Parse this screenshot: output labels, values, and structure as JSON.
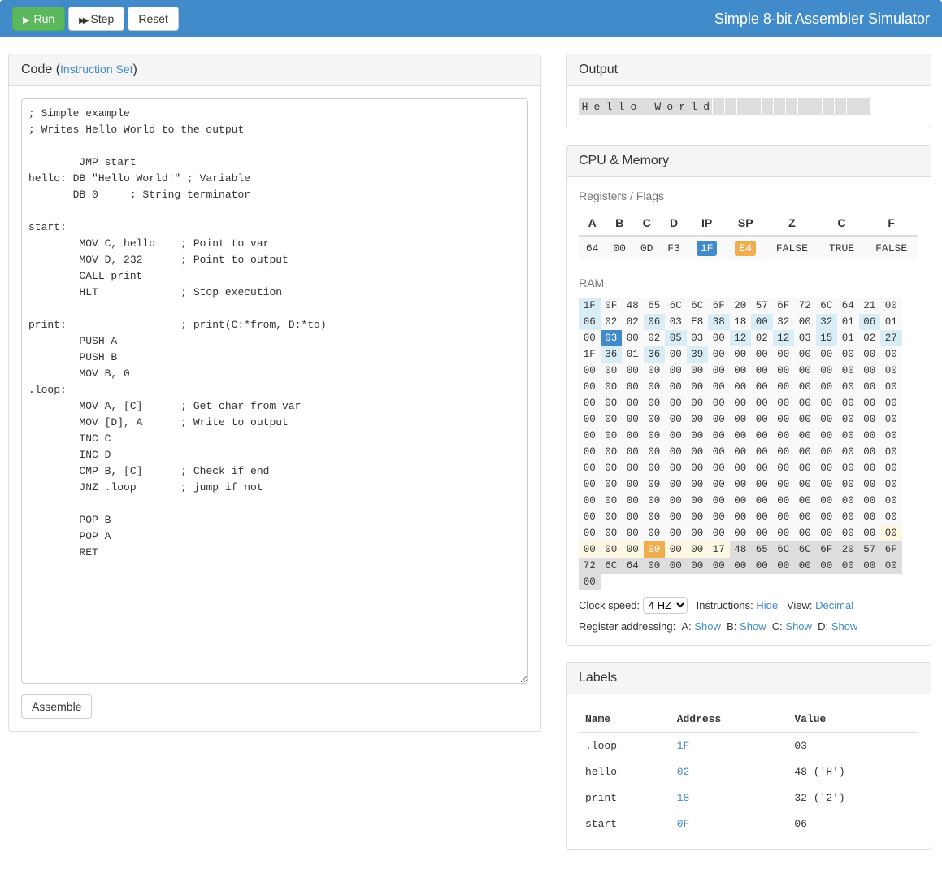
{
  "app": {
    "title": "Simple 8-bit Assembler Simulator"
  },
  "toolbar": {
    "run": "Run",
    "step": "Step",
    "reset": "Reset"
  },
  "codePanel": {
    "title": "Code",
    "instruction_set_link": "Instruction Set",
    "assemble_label": "Assemble",
    "source": "; Simple example\n; Writes Hello World to the output\n\n\tJMP start\nhello: DB \"Hello World!\" ; Variable\n       DB 0\t; String terminator\n\nstart:\n\tMOV C, hello    ; Point to var \n\tMOV D, 232\t; Point to output\n\tCALL print\n        HLT             ; Stop execution\n\nprint:\t\t\t; print(C:*from, D:*to)\n\tPUSH A\n\tPUSH B\n\tMOV B, 0\n.loop:\n\tMOV A, [C]\t; Get char from var\n\tMOV [D], A\t; Write to output\n\tINC C\n\tINC D  \n\tCMP B, [C]\t; Check if end\n\tJNZ .loop\t; jump if not\n\n\tPOP B\n\tPOP A\n\tRET"
  },
  "outputPanel": {
    "title": "Output",
    "cells": [
      "H",
      "e",
      "l",
      "l",
      "o",
      " ",
      "W",
      "o",
      "r",
      "l",
      "d",
      "",
      "",
      "",
      "",
      "",
      "",
      "",
      "",
      "",
      "",
      "",
      "",
      ""
    ]
  },
  "cpuPanel": {
    "title": "CPU & Memory",
    "registers_label": "Registers / Flags",
    "reg_headers": [
      "A",
      "B",
      "C",
      "D",
      "IP",
      "SP",
      "Z",
      "C",
      "F"
    ],
    "reg_values": [
      "64",
      "00",
      "0D",
      "F3",
      "1F",
      "E4",
      "FALSE",
      "TRUE",
      "FALSE"
    ],
    "ram_label": "RAM",
    "ram": [
      {
        "v": "1F",
        "c": "hl-lightblue"
      },
      {
        "v": "0F",
        "c": ""
      },
      {
        "v": "48",
        "c": ""
      },
      {
        "v": "65",
        "c": ""
      },
      {
        "v": "6C",
        "c": ""
      },
      {
        "v": "6C",
        "c": ""
      },
      {
        "v": "6F",
        "c": ""
      },
      {
        "v": "20",
        "c": ""
      },
      {
        "v": "57",
        "c": ""
      },
      {
        "v": "6F",
        "c": ""
      },
      {
        "v": "72",
        "c": ""
      },
      {
        "v": "6C",
        "c": ""
      },
      {
        "v": "64",
        "c": ""
      },
      {
        "v": "21",
        "c": ""
      },
      {
        "v": "00",
        "c": ""
      },
      {
        "v": "06",
        "c": "hl-lightblue"
      },
      {
        "v": "02",
        "c": ""
      },
      {
        "v": "02",
        "c": ""
      },
      {
        "v": "06",
        "c": "hl-lightblue"
      },
      {
        "v": "03",
        "c": ""
      },
      {
        "v": "E8",
        "c": ""
      },
      {
        "v": "38",
        "c": "hl-lightblue"
      },
      {
        "v": "18",
        "c": ""
      },
      {
        "v": "00",
        "c": "hl-lightblue"
      },
      {
        "v": "32",
        "c": ""
      },
      {
        "v": "00",
        "c": ""
      },
      {
        "v": "32",
        "c": "hl-lightblue"
      },
      {
        "v": "01",
        "c": ""
      },
      {
        "v": "06",
        "c": "hl-lightblue"
      },
      {
        "v": "01",
        "c": ""
      },
      {
        "v": "00",
        "c": ""
      },
      {
        "v": "03",
        "c": "hl-ip"
      },
      {
        "v": "00",
        "c": ""
      },
      {
        "v": "02",
        "c": ""
      },
      {
        "v": "05",
        "c": "hl-lightblue"
      },
      {
        "v": "03",
        "c": ""
      },
      {
        "v": "00",
        "c": ""
      },
      {
        "v": "12",
        "c": "hl-lightblue"
      },
      {
        "v": "02",
        "c": ""
      },
      {
        "v": "12",
        "c": "hl-lightblue"
      },
      {
        "v": "03",
        "c": ""
      },
      {
        "v": "15",
        "c": "hl-lightblue"
      },
      {
        "v": "01",
        "c": ""
      },
      {
        "v": "02",
        "c": ""
      },
      {
        "v": "27",
        "c": "hl-lightblue"
      },
      {
        "v": "1F",
        "c": ""
      },
      {
        "v": "36",
        "c": "hl-lightblue"
      },
      {
        "v": "01",
        "c": ""
      },
      {
        "v": "36",
        "c": "hl-lightblue"
      },
      {
        "v": "00",
        "c": ""
      },
      {
        "v": "39",
        "c": "hl-lightblue"
      },
      {
        "v": "00",
        "c": ""
      },
      {
        "v": "00",
        "c": ""
      },
      {
        "v": "00",
        "c": ""
      },
      {
        "v": "00",
        "c": ""
      },
      {
        "v": "00",
        "c": ""
      },
      {
        "v": "00",
        "c": ""
      },
      {
        "v": "00",
        "c": ""
      },
      {
        "v": "00",
        "c": ""
      },
      {
        "v": "00",
        "c": ""
      },
      {
        "v": "00",
        "c": ""
      },
      {
        "v": "00",
        "c": ""
      },
      {
        "v": "00",
        "c": ""
      },
      {
        "v": "00",
        "c": ""
      },
      {
        "v": "00",
        "c": ""
      },
      {
        "v": "00",
        "c": ""
      },
      {
        "v": "00",
        "c": ""
      },
      {
        "v": "00",
        "c": ""
      },
      {
        "v": "00",
        "c": ""
      },
      {
        "v": "00",
        "c": ""
      },
      {
        "v": "00",
        "c": ""
      },
      {
        "v": "00",
        "c": ""
      },
      {
        "v": "00",
        "c": ""
      },
      {
        "v": "00",
        "c": ""
      },
      {
        "v": "00",
        "c": ""
      },
      {
        "v": "00",
        "c": ""
      },
      {
        "v": "00",
        "c": ""
      },
      {
        "v": "00",
        "c": ""
      },
      {
        "v": "00",
        "c": ""
      },
      {
        "v": "00",
        "c": ""
      },
      {
        "v": "00",
        "c": ""
      },
      {
        "v": "00",
        "c": ""
      },
      {
        "v": "00",
        "c": ""
      },
      {
        "v": "00",
        "c": ""
      },
      {
        "v": "00",
        "c": ""
      },
      {
        "v": "00",
        "c": ""
      },
      {
        "v": "00",
        "c": ""
      },
      {
        "v": "00",
        "c": ""
      },
      {
        "v": "00",
        "c": ""
      },
      {
        "v": "00",
        "c": ""
      },
      {
        "v": "00",
        "c": ""
      },
      {
        "v": "00",
        "c": ""
      },
      {
        "v": "00",
        "c": ""
      },
      {
        "v": "00",
        "c": ""
      },
      {
        "v": "00",
        "c": ""
      },
      {
        "v": "00",
        "c": ""
      },
      {
        "v": "00",
        "c": ""
      },
      {
        "v": "00",
        "c": ""
      },
      {
        "v": "00",
        "c": ""
      },
      {
        "v": "00",
        "c": ""
      },
      {
        "v": "00",
        "c": ""
      },
      {
        "v": "00",
        "c": ""
      },
      {
        "v": "00",
        "c": ""
      },
      {
        "v": "00",
        "c": ""
      },
      {
        "v": "00",
        "c": ""
      },
      {
        "v": "00",
        "c": ""
      },
      {
        "v": "00",
        "c": ""
      },
      {
        "v": "00",
        "c": ""
      },
      {
        "v": "00",
        "c": ""
      },
      {
        "v": "00",
        "c": ""
      },
      {
        "v": "00",
        "c": ""
      },
      {
        "v": "00",
        "c": ""
      },
      {
        "v": "00",
        "c": ""
      },
      {
        "v": "00",
        "c": ""
      },
      {
        "v": "00",
        "c": ""
      },
      {
        "v": "00",
        "c": ""
      },
      {
        "v": "00",
        "c": ""
      },
      {
        "v": "00",
        "c": ""
      },
      {
        "v": "00",
        "c": ""
      },
      {
        "v": "00",
        "c": ""
      },
      {
        "v": "00",
        "c": ""
      },
      {
        "v": "00",
        "c": ""
      },
      {
        "v": "00",
        "c": ""
      },
      {
        "v": "00",
        "c": ""
      },
      {
        "v": "00",
        "c": ""
      },
      {
        "v": "00",
        "c": ""
      },
      {
        "v": "00",
        "c": ""
      },
      {
        "v": "00",
        "c": ""
      },
      {
        "v": "00",
        "c": ""
      },
      {
        "v": "00",
        "c": ""
      },
      {
        "v": "00",
        "c": ""
      },
      {
        "v": "00",
        "c": ""
      },
      {
        "v": "00",
        "c": ""
      },
      {
        "v": "00",
        "c": ""
      },
      {
        "v": "00",
        "c": ""
      },
      {
        "v": "00",
        "c": ""
      },
      {
        "v": "00",
        "c": ""
      },
      {
        "v": "00",
        "c": ""
      },
      {
        "v": "00",
        "c": ""
      },
      {
        "v": "00",
        "c": ""
      },
      {
        "v": "00",
        "c": ""
      },
      {
        "v": "00",
        "c": ""
      },
      {
        "v": "00",
        "c": ""
      },
      {
        "v": "00",
        "c": ""
      },
      {
        "v": "00",
        "c": ""
      },
      {
        "v": "00",
        "c": ""
      },
      {
        "v": "00",
        "c": ""
      },
      {
        "v": "00",
        "c": ""
      },
      {
        "v": "00",
        "c": ""
      },
      {
        "v": "00",
        "c": ""
      },
      {
        "v": "00",
        "c": ""
      },
      {
        "v": "00",
        "c": ""
      },
      {
        "v": "00",
        "c": ""
      },
      {
        "v": "00",
        "c": ""
      },
      {
        "v": "00",
        "c": ""
      },
      {
        "v": "00",
        "c": ""
      },
      {
        "v": "00",
        "c": ""
      },
      {
        "v": "00",
        "c": ""
      },
      {
        "v": "00",
        "c": ""
      },
      {
        "v": "00",
        "c": ""
      },
      {
        "v": "00",
        "c": ""
      },
      {
        "v": "00",
        "c": ""
      },
      {
        "v": "00",
        "c": ""
      },
      {
        "v": "00",
        "c": ""
      },
      {
        "v": "00",
        "c": ""
      },
      {
        "v": "00",
        "c": ""
      },
      {
        "v": "00",
        "c": ""
      },
      {
        "v": "00",
        "c": ""
      },
      {
        "v": "00",
        "c": ""
      },
      {
        "v": "00",
        "c": ""
      },
      {
        "v": "00",
        "c": ""
      },
      {
        "v": "00",
        "c": ""
      },
      {
        "v": "00",
        "c": ""
      },
      {
        "v": "00",
        "c": ""
      },
      {
        "v": "00",
        "c": ""
      },
      {
        "v": "00",
        "c": ""
      },
      {
        "v": "00",
        "c": ""
      },
      {
        "v": "00",
        "c": ""
      },
      {
        "v": "00",
        "c": ""
      },
      {
        "v": "00",
        "c": ""
      },
      {
        "v": "00",
        "c": ""
      },
      {
        "v": "00",
        "c": ""
      },
      {
        "v": "00",
        "c": ""
      },
      {
        "v": "00",
        "c": ""
      },
      {
        "v": "00",
        "c": ""
      },
      {
        "v": "00",
        "c": ""
      },
      {
        "v": "00",
        "c": ""
      },
      {
        "v": "00",
        "c": ""
      },
      {
        "v": "00",
        "c": ""
      },
      {
        "v": "00",
        "c": ""
      },
      {
        "v": "00",
        "c": ""
      },
      {
        "v": "00",
        "c": ""
      },
      {
        "v": "00",
        "c": ""
      },
      {
        "v": "00",
        "c": ""
      },
      {
        "v": "00",
        "c": ""
      },
      {
        "v": "00",
        "c": ""
      },
      {
        "v": "00",
        "c": ""
      },
      {
        "v": "00",
        "c": ""
      },
      {
        "v": "00",
        "c": ""
      },
      {
        "v": "00",
        "c": ""
      },
      {
        "v": "00",
        "c": ""
      },
      {
        "v": "00",
        "c": ""
      },
      {
        "v": "00",
        "c": ""
      },
      {
        "v": "00",
        "c": ""
      },
      {
        "v": "00",
        "c": ""
      },
      {
        "v": "00",
        "c": ""
      },
      {
        "v": "00",
        "c": ""
      },
      {
        "v": "00",
        "c": ""
      },
      {
        "v": "00",
        "c": ""
      },
      {
        "v": "00",
        "c": ""
      },
      {
        "v": "00",
        "c": ""
      },
      {
        "v": "00",
        "c": ""
      },
      {
        "v": "00",
        "c": ""
      },
      {
        "v": "00",
        "c": ""
      },
      {
        "v": "00",
        "c": ""
      },
      {
        "v": "00",
        "c": ""
      },
      {
        "v": "00",
        "c": ""
      },
      {
        "v": "00",
        "c": ""
      },
      {
        "v": "00",
        "c": ""
      },
      {
        "v": "00",
        "c": ""
      },
      {
        "v": "00",
        "c": ""
      },
      {
        "v": "00",
        "c": ""
      },
      {
        "v": "00",
        "c": ""
      },
      {
        "v": "00",
        "c": ""
      },
      {
        "v": "00",
        "c": "hl-sp-light"
      },
      {
        "v": "00",
        "c": "hl-sp-light"
      },
      {
        "v": "00",
        "c": "hl-sp-light"
      },
      {
        "v": "00",
        "c": "hl-sp-light"
      },
      {
        "v": "00",
        "c": "hl-sp"
      },
      {
        "v": "00",
        "c": "hl-sp-light"
      },
      {
        "v": "00",
        "c": "hl-sp-light"
      },
      {
        "v": "17",
        "c": "hl-sp-light"
      },
      {
        "v": "48",
        "c": "hl-output"
      },
      {
        "v": "65",
        "c": "hl-output"
      },
      {
        "v": "6C",
        "c": "hl-output"
      },
      {
        "v": "6C",
        "c": "hl-output"
      },
      {
        "v": "6F",
        "c": "hl-output"
      },
      {
        "v": "20",
        "c": "hl-output"
      },
      {
        "v": "57",
        "c": "hl-output"
      },
      {
        "v": "6F",
        "c": "hl-output"
      },
      {
        "v": "72",
        "c": "hl-output"
      },
      {
        "v": "6C",
        "c": "hl-output"
      },
      {
        "v": "64",
        "c": "hl-output"
      },
      {
        "v": "00",
        "c": "hl-output"
      },
      {
        "v": "00",
        "c": "hl-output"
      },
      {
        "v": "00",
        "c": "hl-output"
      },
      {
        "v": "00",
        "c": "hl-output"
      },
      {
        "v": "00",
        "c": "hl-output"
      },
      {
        "v": "00",
        "c": "hl-output"
      },
      {
        "v": "00",
        "c": "hl-output"
      },
      {
        "v": "00",
        "c": "hl-output"
      },
      {
        "v": "00",
        "c": "hl-output"
      },
      {
        "v": "00",
        "c": "hl-output"
      },
      {
        "v": "00",
        "c": "hl-output"
      },
      {
        "v": "00",
        "c": "hl-output"
      },
      {
        "v": "00",
        "c": "hl-output"
      }
    ],
    "clock_label": "Clock speed:",
    "clock_value": "4 HZ",
    "instructions_label": "Instructions:",
    "instructions_link": "Hide",
    "view_label": "View:",
    "view_link": "Decimal",
    "reg_addr_label": "Register addressing:",
    "reg_addr": [
      {
        "reg": "A:",
        "link": "Show"
      },
      {
        "reg": "B:",
        "link": "Show"
      },
      {
        "reg": "C:",
        "link": "Show"
      },
      {
        "reg": "D:",
        "link": "Show"
      }
    ]
  },
  "labelsPanel": {
    "title": "Labels",
    "headers": [
      "Name",
      "Address",
      "Value"
    ],
    "rows": [
      {
        "name": ".loop",
        "addr": "1F",
        "value": "03"
      },
      {
        "name": "hello",
        "addr": "02",
        "value": "48 ('H')"
      },
      {
        "name": "print",
        "addr": "18",
        "value": "32 ('2')"
      },
      {
        "name": "start",
        "addr": "0F",
        "value": "06"
      }
    ]
  }
}
